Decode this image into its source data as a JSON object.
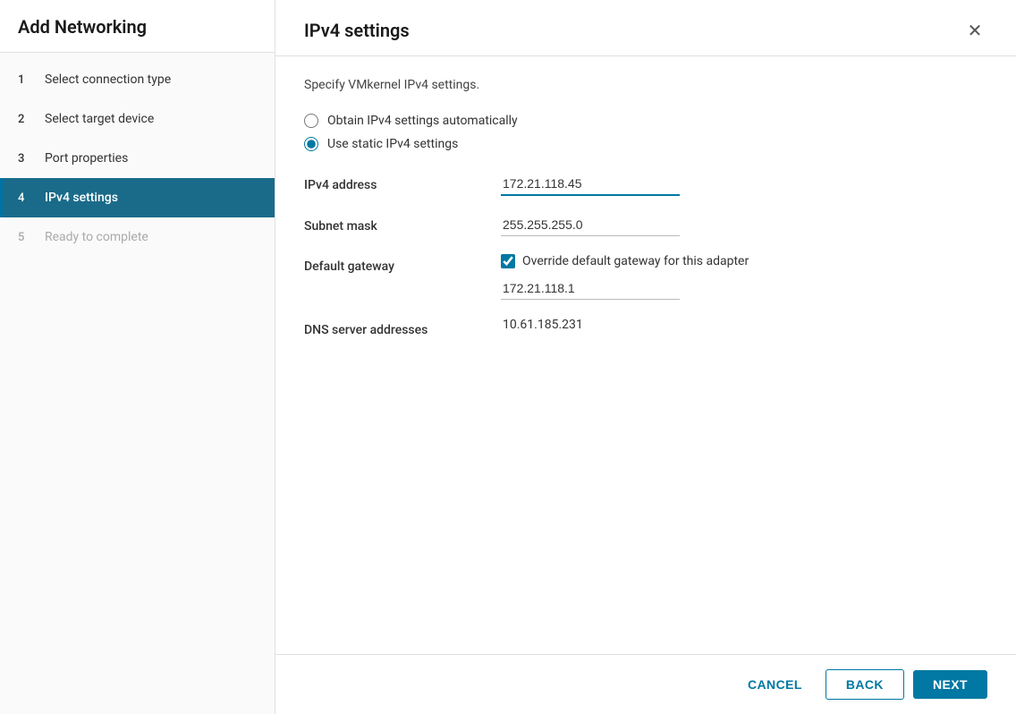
{
  "sidebar": {
    "title": "Add Networking",
    "steps": [
      {
        "number": "1",
        "label": "Select connection type",
        "state": "completed"
      },
      {
        "number": "2",
        "label": "Select target device",
        "state": "completed"
      },
      {
        "number": "3",
        "label": "Port properties",
        "state": "completed"
      },
      {
        "number": "4",
        "label": "IPv4 settings",
        "state": "active"
      },
      {
        "number": "5",
        "label": "Ready to complete",
        "state": "disabled"
      }
    ]
  },
  "main": {
    "title": "IPv4 settings",
    "subtitle": "Specify VMkernel IPv4 settings.",
    "radio_obtain": "Obtain IPv4 settings automatically",
    "radio_static": "Use static IPv4 settings",
    "ipv4_address_label": "IPv4 address",
    "ipv4_address_value": "172.21.118.45",
    "subnet_mask_label": "Subnet mask",
    "subnet_mask_value": "255.255.255.0",
    "default_gateway_label": "Default gateway",
    "override_gateway_label": "Override default gateway for this adapter",
    "gateway_value": "172.21.118.1",
    "dns_label": "DNS server addresses",
    "dns_value": "10.61.185.231"
  },
  "footer": {
    "cancel_label": "CANCEL",
    "back_label": "BACK",
    "next_label": "NEXT"
  }
}
